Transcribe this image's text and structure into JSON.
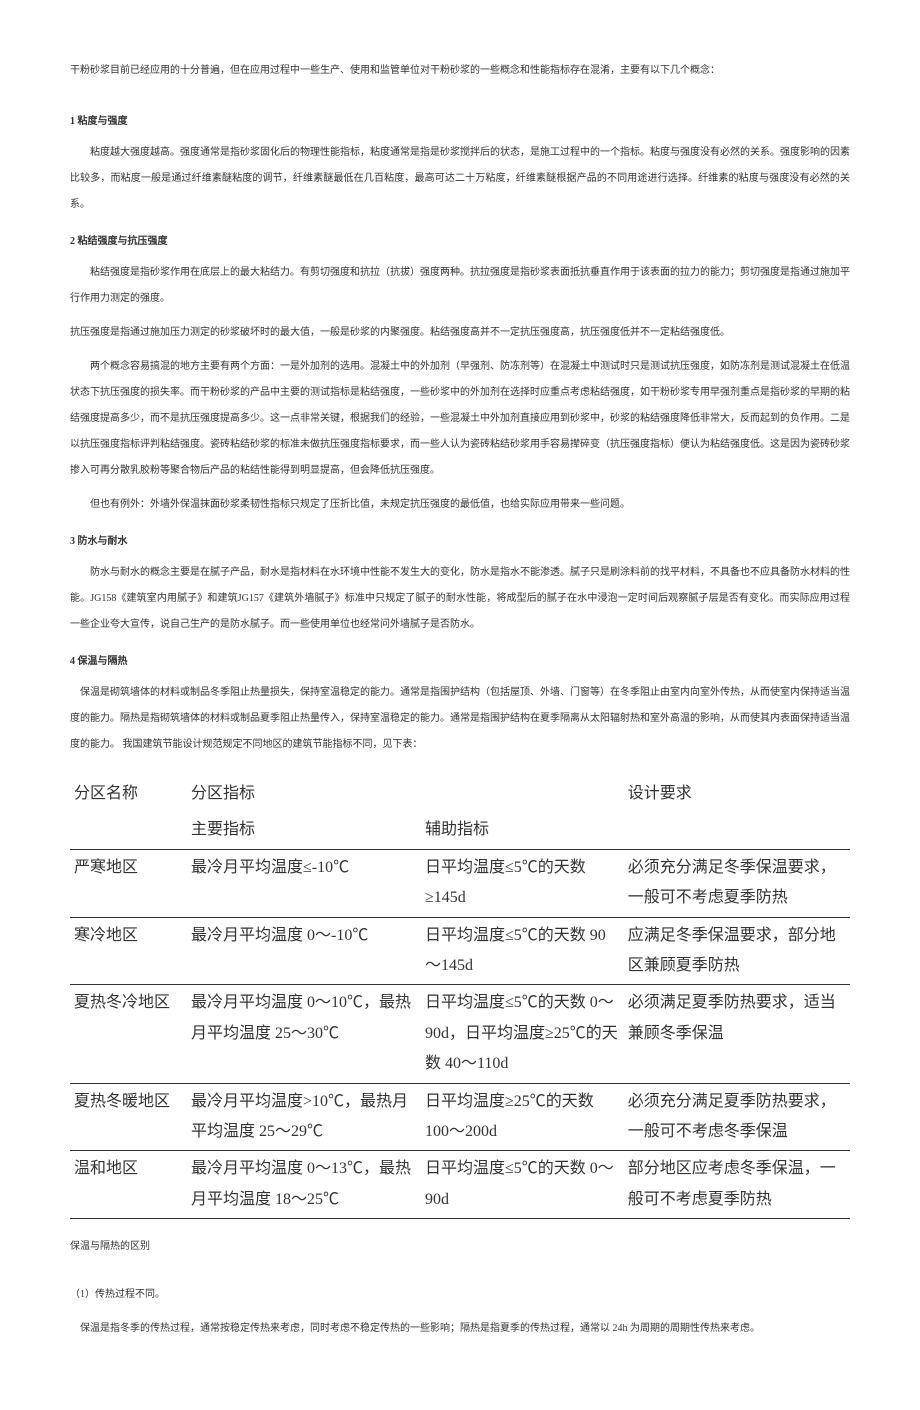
{
  "intro": "干粉砂浆目前已经应用的十分普遍，但在应用过程中一些生产、使用和监管单位对干粉砂浆的一些概念和性能指标存在混淆，主要有以下几个概念：",
  "s1": {
    "heading": "1 粘度与强度",
    "p1": "粘度越大强度越高。强度通常是指砂浆固化后的物理性能指标，粘度通常是指是砂浆搅拌后的状态，是施工过程中的一个指标。粘度与强度没有必然的关系。强度影响的因素比较多，而粘度一般是通过纤维素醚粘度的调节，纤维素醚最低在几百粘度，最高可达二十万粘度，纤维素醚根据产品的不同用途进行选择。纤维素的粘度与强度没有必然的关系。"
  },
  "s2": {
    "heading": "2 粘结强度与抗压强度",
    "p1": "粘结强度是指砂浆作用在底层上的最大粘结力。有剪切强度和抗拉（抗拔）强度两种。抗拉强度是指砂浆表面抵抗垂直作用于该表面的拉力的能力；剪切强度是指通过施加平行作用力测定的强度。",
    "p2": "抗压强度是指通过施加压力测定的砂浆破坏时的最大值，一般是砂浆的内聚强度。粘结强度高并不一定抗压强度高，抗压强度低并不一定粘结强度低。",
    "p3": "两个概念容易搞混的地方主要有两个方面：一是外加剂的选用。混凝土中的外加剂（早强剂、防冻剂等）在混凝土中测试时只是测试抗压强度，如防冻剂是测试混凝土在低温状态下抗压强度的损失率。而干粉砂浆的产品中主要的测试指标是粘结强度，一些砂浆中的外加剂在选择时应重点考虑粘结强度，如干粉砂浆专用早强剂重点是指砂浆的早期的粘结强度提高多少，而不是抗压强度提高多少。这一点非常关键，根据我们的经验，一些混凝土中外加剂直接应用到砂浆中，砂浆的粘结强度降低非常大，反而起到的负作用。二是以抗压强度指标评判粘结强度。瓷砖粘结砂浆的标准未做抗压强度指标要求，而一些人认为瓷砖粘结砂浆用手容易撵碎变（抗压强度指标）便认为粘结强度低。这是因为瓷砖砂浆掺入可再分散乳胶粉等聚合物后产品的粘结性能得到明显提高，但会降低抗压强度。",
    "p4": "但也有例外：外墙外保温抹面砂浆柔韧性指标只规定了压折比值，未规定抗压强度的最低值，也给实际应用带来一些问题。"
  },
  "s3": {
    "heading": "3 防水与耐水",
    "p1": "防水与耐水的概念主要是在腻子产品，耐水是指材料在水环境中性能不发生大的变化，防水是指水不能渗透。腻子只是刷涂料前的找平材料，不具备也不应具备防水材料的性能。JG158《建筑室内用腻子》和建筑JG157《建筑外墙腻子》标准中只规定了腻子的耐水性能，将成型后的腻子在水中浸泡一定时间后观察腻子层是否有变化。而实际应用过程一些企业夸大宣传，说自己生产的是防水腻子。而一些使用单位也经常问外墙腻子是否防水。"
  },
  "s4": {
    "heading": "4 保温与隔热",
    "p1": "保温是砌筑墙体的材料或制品冬季阻止热量损失，保持室温稳定的能力。通常是指围护结构（包括屋顶、外墙、门窗等）在冬季阻止由室内向室外传热，从而使室内保持适当温度的能力。隔热是指砌筑墙体的材料或制品夏季阻止热量传入，保持室温稳定的能力。通常是指围护结构在夏季隔离从太阳辐射热和室外高温的影响，从而使其内表面保持适当温度的能力。  我国建筑节能设计规范规定不同地区的建筑节能指标不同，见下表："
  },
  "table": {
    "headers": {
      "name": "分区名称",
      "indicator": "分区指标",
      "main": "主要指标",
      "aux": "辅助指标",
      "req": "设计要求"
    },
    "rows": [
      {
        "name": "严寒地区",
        "main": "最冷月平均温度≤-10℃",
        "aux": "日平均温度≤5℃的天数≥145d",
        "req": "必须充分满足冬季保温要求，一般可不考虑夏季防热"
      },
      {
        "name": "寒冷地区",
        "main": "最冷月平均温度 0～-10℃",
        "aux": "日平均温度≤5℃的天数 90～145d",
        "req": "应满足冬季保温要求，部分地区兼顾夏季防热"
      },
      {
        "name": "夏热冬冷地区",
        "main": "最冷月平均温度 0～10℃，最热月平均温度 25～30℃",
        "aux": "日平均温度≤5℃的天数 0～90d，日平均温度≥25℃的天数 40～110d",
        "req": "必须满足夏季防热要求，适当兼顾冬季保温"
      },
      {
        "name": "夏热冬暖地区",
        "main": "最冷月平均温度>10℃，最热月平均温度 25～29℃",
        "aux": "日平均温度≥25℃的天数 100～200d",
        "req": "必须充分满足夏季防热要求，一般可不考虑冬季保温"
      },
      {
        "name": "温和地区",
        "main": "最冷月平均温度 0～13℃，最热月平均温度 18～25℃",
        "aux": "日平均温度≤5℃的天数 0～90d",
        "req": "部分地区应考虑冬季保温，一般可不考虑夏季防热"
      }
    ]
  },
  "tableNote": "保温与隔热的区别",
  "end": {
    "p1": "（1）传热过程不同。",
    "p2": "保温是指冬季的传热过程，通常按稳定传热来考虑，同时考虑不稳定传热的一些影响；隔热是指夏季的传热过程，通常以 24h 为周期的周期性传热来考虑。"
  }
}
